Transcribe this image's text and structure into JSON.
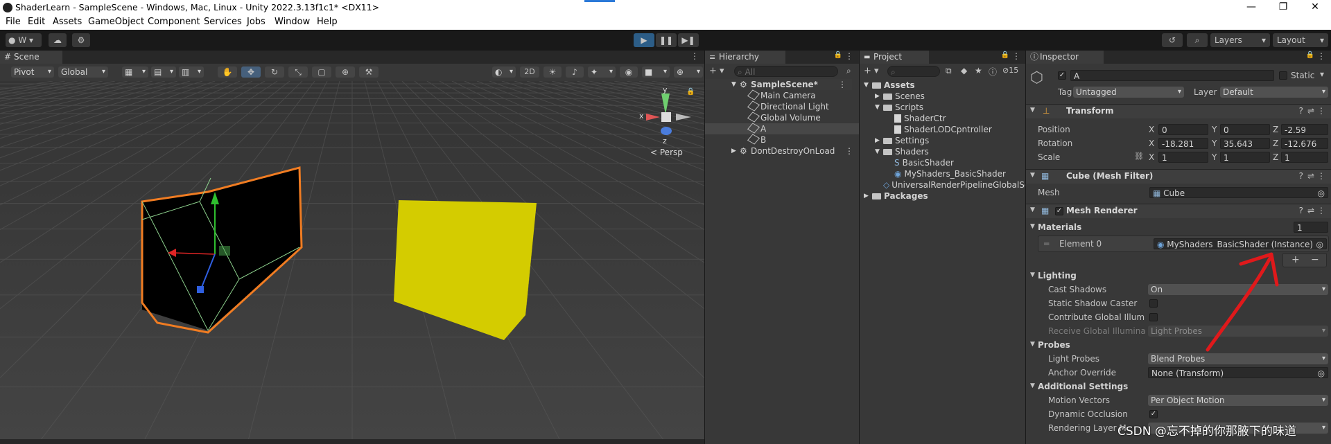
{
  "window": {
    "title": "ShaderLearn - SampleScene - Windows, Mac, Linux - Unity 2022.3.13f1c1* <DX11>",
    "minimize": "—",
    "maximize": "❐",
    "close": "✕"
  },
  "menu": [
    "File",
    "Edit",
    "Assets",
    "GameObject",
    "Component",
    "Services",
    "Jobs",
    "Window",
    "Help"
  ],
  "toolbar": {
    "account": "W",
    "layers": "Layers",
    "layout": "Layout",
    "play_icon": "play-icon",
    "pause_icon": "pause-icon",
    "step_icon": "step-icon"
  },
  "scene": {
    "tab": "Scene",
    "pivot": "Pivot",
    "global": "Global",
    "mode_2d": "2D",
    "persp": "Persp",
    "gizmo_y": "y",
    "gizmo_x": "x",
    "gizmo_z": "z"
  },
  "hierarchy": {
    "tab": "Hierarchy",
    "search_placeholder": "All",
    "scene": "SampleScene*",
    "items": [
      "Main Camera",
      "Directional Light",
      "Global Volume",
      "A",
      "B"
    ],
    "dont_destroy": "DontDestroyOnLoad"
  },
  "project": {
    "tab": "Project",
    "tree": {
      "assets": "Assets",
      "scenes": "Scenes",
      "scripts": "Scripts",
      "script_items": [
        "ShaderCtr",
        "ShaderLODCpntroller"
      ],
      "settings": "Settings",
      "shaders": "Shaders",
      "shader_items": [
        "BasicShader",
        "MyShaders_BasicShader"
      ],
      "urp_global": "UniversalRenderPipelineGlobalSe",
      "packages": "Packages"
    },
    "badge": "15"
  },
  "inspector": {
    "tab": "Inspector",
    "object_name": "A",
    "static_label": "Static",
    "tag_label": "Tag",
    "tag_value": "Untagged",
    "layer_label": "Layer",
    "layer_value": "Default",
    "transform": {
      "title": "Transform",
      "rows": [
        {
          "label": "Position",
          "x": "0",
          "y": "0",
          "z": "-2.59"
        },
        {
          "label": "Rotation",
          "x": "-18.281",
          "y": "35.643",
          "z": "-12.676"
        },
        {
          "label": "Scale",
          "x": "1",
          "y": "1",
          "z": "1"
        }
      ],
      "axis_x": "X",
      "axis_y": "Y",
      "axis_z": "Z"
    },
    "mesh_filter": {
      "title": "Cube (Mesh Filter)",
      "mesh_label": "Mesh",
      "mesh_value": "Cube"
    },
    "mesh_renderer": {
      "title": "Mesh Renderer",
      "materials_label": "Materials",
      "materials_count": "1",
      "element_label": "Element 0",
      "element_value": "MyShaders_BasicShader (Instance)",
      "plus": "+",
      "minus": "−",
      "lighting": "Lighting",
      "cast_shadows_label": "Cast Shadows",
      "cast_shadows_value": "On",
      "static_shadow_caster": "Static Shadow Caster",
      "contribute_gi": "Contribute Global Illumina",
      "receive_gi": "Receive Global Illuminatic",
      "receive_gi_value": "Light Probes",
      "probes": "Probes",
      "light_probes_label": "Light Probes",
      "light_probes_value": "Blend Probes",
      "anchor_label": "Anchor Override",
      "anchor_value": "None (Transform)",
      "additional": "Additional Settings",
      "motion_vectors_label": "Motion Vectors",
      "motion_vectors_value": "Per Object Motion",
      "dynamic_occlusion": "Dynamic Occlusion",
      "rendering_layer": "Rendering Layer M"
    }
  },
  "watermark": "CSDN @忘不掉的你那腋下的味道",
  "colors": {
    "selection_orange": "#f07c22",
    "cube_yellow": "#d4cc00",
    "annotation_red": "#e0191b",
    "play_blue": "#2c5d87"
  }
}
